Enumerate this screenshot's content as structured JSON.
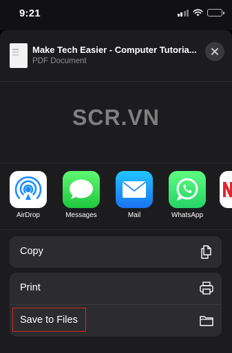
{
  "status": {
    "time": "9:21"
  },
  "share_sheet": {
    "title": "Make Tech Easier - Computer Tutoria...",
    "subtitle": "PDF Document"
  },
  "watermark": "SCR.VN",
  "apps": [
    {
      "label": "AirDrop",
      "icon": "airdrop-icon"
    },
    {
      "label": "Messages",
      "icon": "messages-icon"
    },
    {
      "label": "Mail",
      "icon": "mail-icon"
    },
    {
      "label": "WhatsApp",
      "icon": "whatsapp-icon"
    }
  ],
  "actions": {
    "copy": {
      "label": "Copy",
      "icon": "copy-icon"
    },
    "print": {
      "label": "Print",
      "icon": "printer-icon"
    },
    "save_to_files": {
      "label": "Save to Files",
      "icon": "folder-icon"
    }
  },
  "colors": {
    "highlight": "#d0292c",
    "sheet_bg": "#1c1c1e",
    "row_bg": "#2c2c2e"
  }
}
